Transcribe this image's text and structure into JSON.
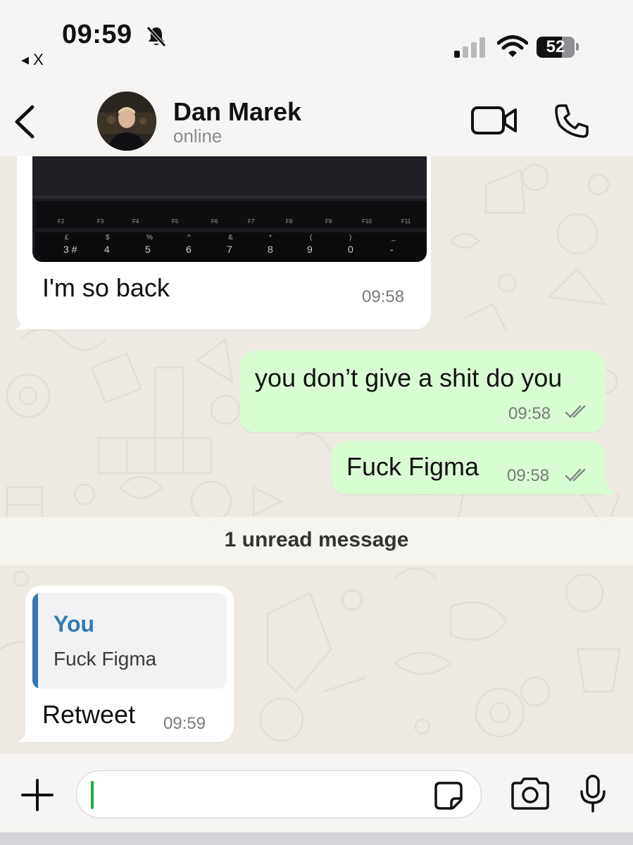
{
  "status_bar": {
    "time": "09:59",
    "back_app": "◂ X",
    "battery": "52"
  },
  "header": {
    "contact_name": "Dan Marek",
    "contact_status": "online"
  },
  "keyboard_photo": {
    "fn_keys": [
      "F2",
      "F3",
      "F4",
      "F5",
      "F6",
      "F7",
      "F8",
      "F9",
      "F10",
      "F11"
    ],
    "number_keys": [
      "3 #",
      "4",
      "5",
      "6",
      "7",
      "8",
      "9",
      "0",
      "-"
    ],
    "symbol_keys": [
      "£",
      "$",
      "%",
      "^",
      "&",
      "*",
      "(",
      ")",
      "_"
    ]
  },
  "messages": [
    {
      "direction": "in",
      "text": "I'm so back",
      "time": "09:58"
    },
    {
      "direction": "out",
      "text": "you don’t give a shit do you",
      "time": "09:58"
    },
    {
      "direction": "out",
      "text": "Fuck Figma",
      "time": "09:58"
    }
  ],
  "unread_divider": "1 unread message",
  "reply_message": {
    "quoted_author": "You",
    "quoted_text": "Fuck Figma",
    "text": "Retweet",
    "time": "09:59"
  },
  "colors": {
    "outgoing_bubble": "#d9fdd3",
    "incoming_bubble": "#ffffff",
    "quote_accent": "#3478b7",
    "caret": "#25a849"
  }
}
